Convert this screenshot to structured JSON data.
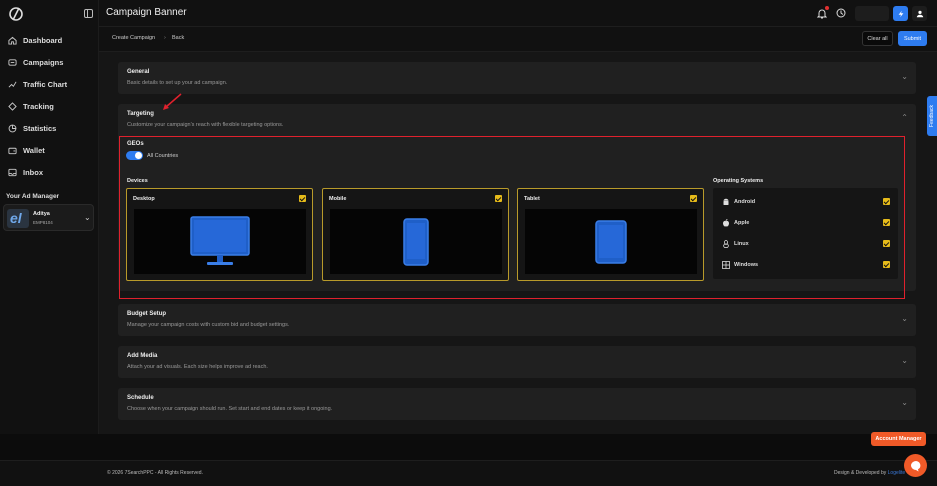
{
  "header": {
    "title": "Campaign Banner"
  },
  "breadcrumb": {
    "items": [
      "Create Campaign",
      "Back"
    ]
  },
  "actions": {
    "clear_label": "Clear all",
    "submit_label": "Submit"
  },
  "sidebar": {
    "items": [
      {
        "label": "Dashboard",
        "icon": "home-icon"
      },
      {
        "label": "Campaigns",
        "icon": "megaphone-icon"
      },
      {
        "label": "Traffic Chart",
        "icon": "chart-icon"
      },
      {
        "label": "Tracking",
        "icon": "tracking-icon"
      },
      {
        "label": "Statistics",
        "icon": "statistics-icon"
      },
      {
        "label": "Wallet",
        "icon": "wallet-icon"
      },
      {
        "label": "Inbox",
        "icon": "inbox-icon"
      }
    ],
    "manager": {
      "title": "Your Ad Manager",
      "name": "Aditya",
      "id": "EMP8104",
      "avatar_letter": "el"
    }
  },
  "sections": {
    "general": {
      "title": "General",
      "desc": "Basic details to set up your ad campaign."
    },
    "targeting": {
      "title": "Targeting",
      "desc": "Customize your campaign's reach with flexible targeting options."
    },
    "budget": {
      "title": "Budget Setup",
      "desc": "Manage your campaign costs with custom bid and budget settings."
    },
    "media": {
      "title": "Add Media",
      "desc": "Attach your ad visuals. Each size helps improve ad reach."
    },
    "schedule": {
      "title": "Schedule",
      "desc": "Choose when your campaign should run. Set start and end dates or keep it ongoing."
    }
  },
  "targeting": {
    "geos_label": "GEOs",
    "all_countries": {
      "label": "All Countries",
      "enabled": true
    },
    "devices_label": "Devices",
    "devices": [
      {
        "name": "Desktop",
        "checked": true
      },
      {
        "name": "Mobile",
        "checked": true
      },
      {
        "name": "Tablet",
        "checked": true
      }
    ],
    "os_label": "Operating Systems",
    "os": [
      {
        "name": "Android",
        "checked": true
      },
      {
        "name": "Apple",
        "checked": true
      },
      {
        "name": "Linux",
        "checked": true
      },
      {
        "name": "Windows",
        "checked": true
      }
    ]
  },
  "footer": {
    "copyright_prefix": "© 2026 7SearchPPC",
    "copyright_suffix": " - All Rights Reserved.",
    "credit_text": "Design & Developed by ",
    "credit_link": "Logelite"
  },
  "widgets": {
    "feedback_label": "Feedback",
    "account_manager_label": "Account Manager"
  },
  "colors": {
    "accent": "#2e7cf0",
    "highlight_border": "#e0212d",
    "checkbox": "#e6bb1a",
    "device_border": "#b89a2a",
    "chat": "#f05a28"
  }
}
